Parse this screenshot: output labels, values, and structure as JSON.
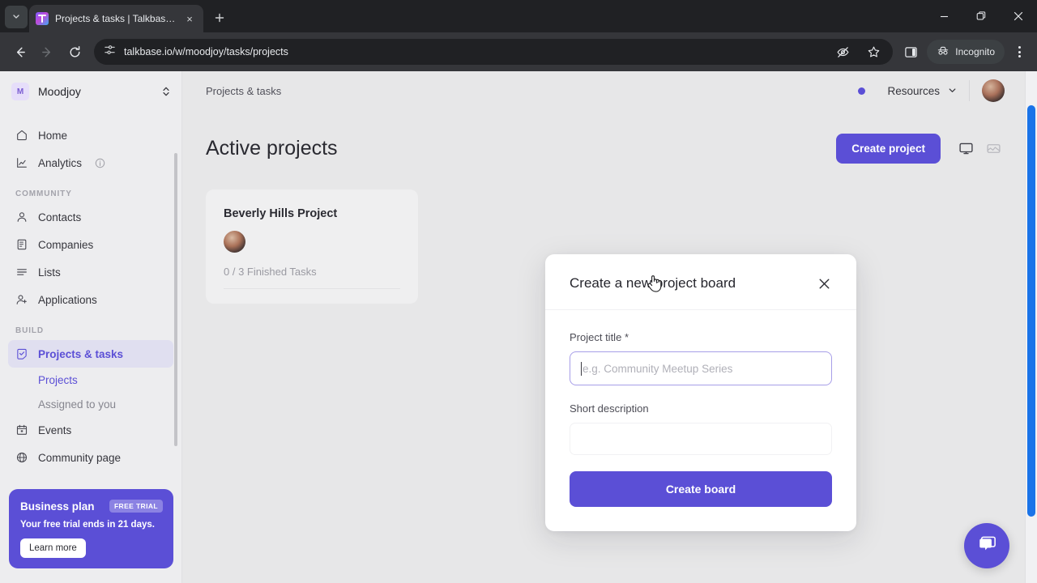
{
  "browser": {
    "tab": {
      "title": "Projects & tasks | Talkbase.io",
      "favicon_name": "talkbase-favicon",
      "close_label": "×"
    },
    "new_tab_label": "+",
    "tab_search_label": "⌄",
    "window": {
      "minimize": "–",
      "maximize": "❐",
      "close": "×"
    },
    "nav": {
      "back": "←",
      "forward": "→",
      "reload": "⟳"
    },
    "omnibox": {
      "url": "talkbase.io/w/moodjoy/tasks/projects",
      "site_settings_icon": "tune-icon",
      "tracking_icon": "eye-off-icon",
      "bookmark_icon": "star-icon"
    },
    "side_panel_icon": "side-panel-icon",
    "incognito_label": "Incognito",
    "menu_icon": "three-dots-icon"
  },
  "sidebar": {
    "workspace": {
      "initial": "M",
      "name": "Moodjoy"
    },
    "items": [
      {
        "label": "Home",
        "icon": "home-icon"
      },
      {
        "label": "Analytics",
        "icon": "chart-line-icon",
        "info": true
      }
    ],
    "sections": [
      {
        "label": "COMMUNITY",
        "items": [
          {
            "label": "Contacts",
            "icon": "person-icon"
          },
          {
            "label": "Companies",
            "icon": "building-icon"
          },
          {
            "label": "Lists",
            "icon": "list-icon"
          },
          {
            "label": "Applications",
            "icon": "person-plus-icon"
          }
        ]
      },
      {
        "label": "BUILD",
        "items": [
          {
            "label": "Projects & tasks",
            "icon": "check-square-icon",
            "active": true
          },
          {
            "label": "Projects",
            "sub": true,
            "current": true
          },
          {
            "label": "Assigned to you",
            "sub": true
          },
          {
            "label": "Events",
            "icon": "calendar-icon"
          },
          {
            "label": "Community page",
            "icon": "globe-icon"
          }
        ]
      }
    ],
    "plan_card": {
      "title": "Business plan",
      "badge": "FREE TRIAL",
      "subtitle": "Your free trial ends in 21 days.",
      "button": "Learn more"
    }
  },
  "header": {
    "breadcrumb": "Projects & tasks",
    "resources_label": "Resources",
    "chevron": "⌄",
    "status_dot_color": "#5b4fd6",
    "avatar_name": "user-avatar"
  },
  "main": {
    "page_title": "Active projects",
    "create_project_label": "Create project",
    "view_toggles": [
      {
        "name": "board-view-icon",
        "active": true
      },
      {
        "name": "gallery-view-icon",
        "active": false
      }
    ],
    "projects": [
      {
        "title": "Beverly Hills Project",
        "meta": "0 / 3 Finished Tasks",
        "avatar_name": "project-member-avatar"
      }
    ]
  },
  "modal": {
    "title": "Create a new project board",
    "close_label": "×",
    "fields": [
      {
        "label": "Project title",
        "required_marker": "*",
        "value": "",
        "placeholder": "e.g. Community Meetup Series",
        "focused": true
      },
      {
        "label": "Short description",
        "required_marker": "",
        "value": "",
        "placeholder": "",
        "focused": false
      }
    ],
    "submit_label": "Create board"
  },
  "chat": {
    "icon_name": "chat-bubble-icon"
  },
  "colors": {
    "accent": "#5b4fd6",
    "accent_soft": "#e0dff0",
    "page_bg": "#e7e7e8",
    "sidebar_bg": "#ededef",
    "scrollbar_thumb": "#1a73e8"
  }
}
